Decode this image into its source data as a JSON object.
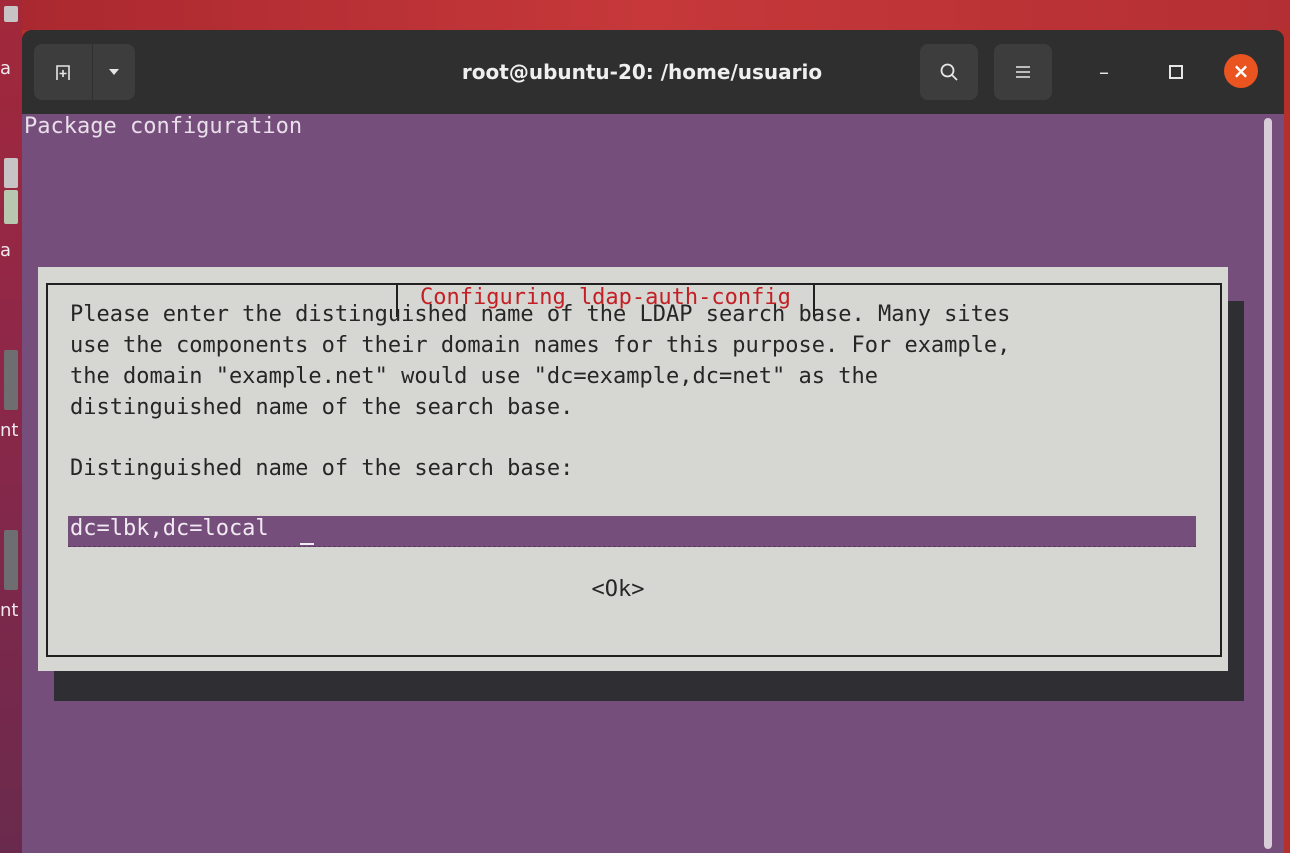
{
  "window": {
    "title": "root@ubuntu-20: /home/usuario",
    "new_tab_icon": "new-tab-icon",
    "dropdown_icon": "chevron-down-icon",
    "search_icon": "search-icon",
    "menu_icon": "hamburger-menu-icon",
    "minimize_glyph": "–",
    "close_glyph": "×",
    "close_color": "#e95420"
  },
  "terminal": {
    "background": "#764e7b",
    "header_text": "Package configuration"
  },
  "dialog": {
    "title": "Configuring ldap-auth-config",
    "body_lines": [
      "Please enter the distinguished name of the LDAP search base. Many sites",
      "use the components of their domain names for this purpose. For example,",
      "the domain \"example.net\" would use \"dc=example,dc=net\" as the",
      "distinguished name of the search base."
    ],
    "prompt": "Distinguished name of the search base:",
    "input_value": "dc=lbk,dc=local",
    "ok_label": "<Ok>"
  },
  "desktop": {
    "left_fragments": [
      "a",
      "a",
      "nt",
      "nt"
    ]
  }
}
